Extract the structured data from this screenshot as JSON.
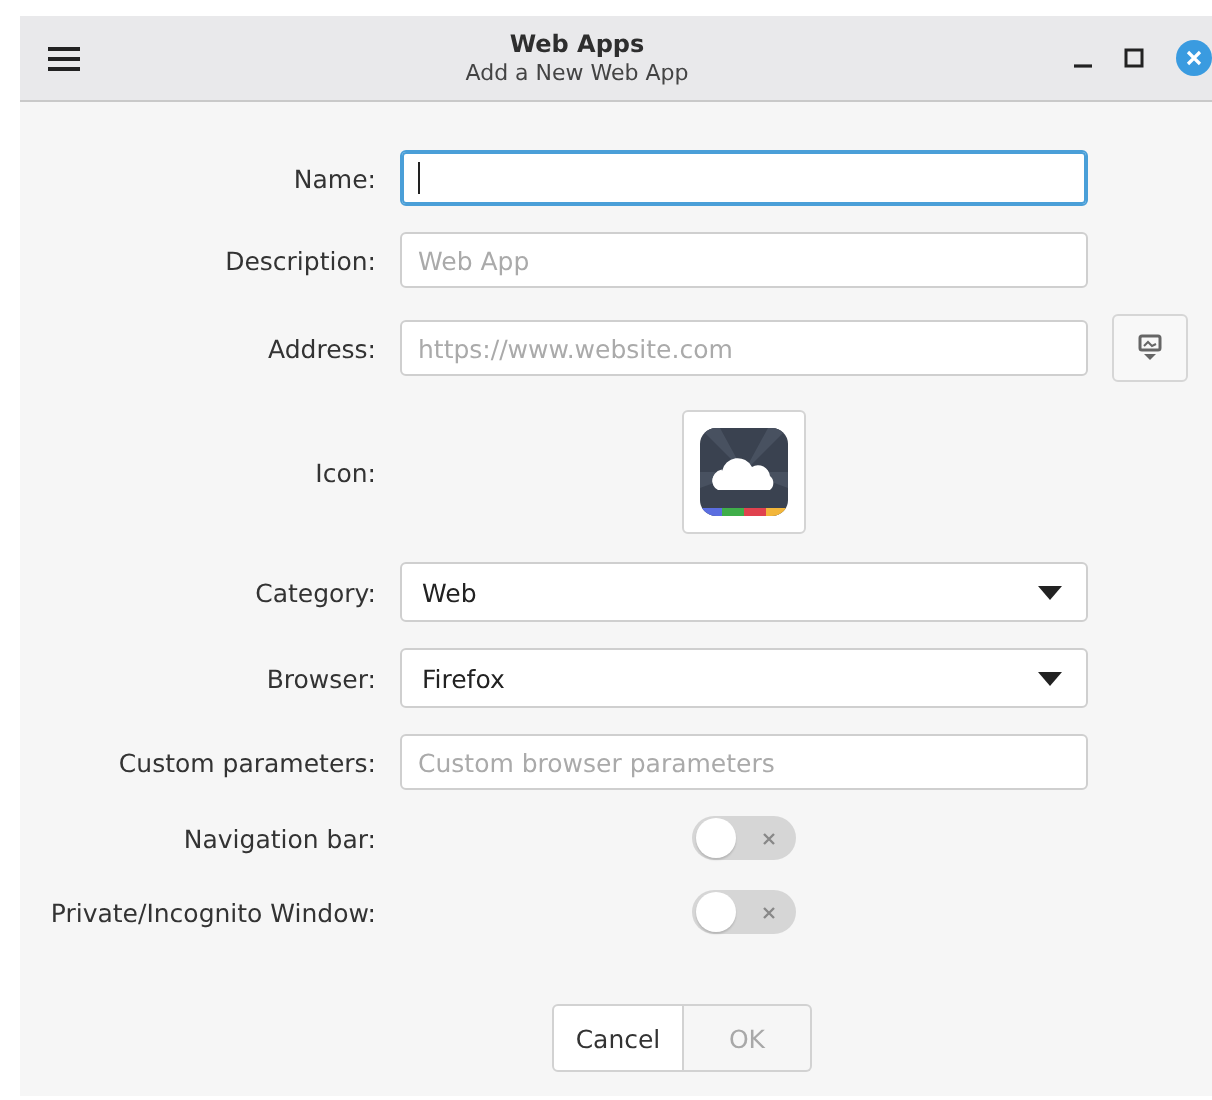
{
  "window": {
    "title": "Web Apps",
    "subtitle": "Add a New Web App"
  },
  "form": [
    {
      "kind": "text",
      "label": "Name:",
      "focused": true
    },
    {
      "kind": "text",
      "label": "Description:",
      "placeholder": "Web App",
      "focused": false
    },
    {
      "kind": "address",
      "label": "Address:",
      "placeholder": "https://www.website.com",
      "focused": false
    },
    {
      "kind": "icon",
      "label": "Icon:"
    },
    {
      "kind": "dropdown",
      "label": "Category:",
      "value": "Web"
    },
    {
      "kind": "dropdown",
      "label": "Browser:",
      "value": "Firefox"
    },
    {
      "kind": "text",
      "label": "Custom parameters:",
      "placeholder": "Custom browser parameters",
      "focused": false
    },
    {
      "kind": "toggle",
      "label": "Navigation bar:",
      "on": false
    },
    {
      "kind": "toggle",
      "label": "Private/Incognito Window:",
      "on": false
    }
  ],
  "buttons": [
    {
      "label": "Cancel",
      "disabled": false
    },
    {
      "label": "OK",
      "disabled": true
    }
  ]
}
